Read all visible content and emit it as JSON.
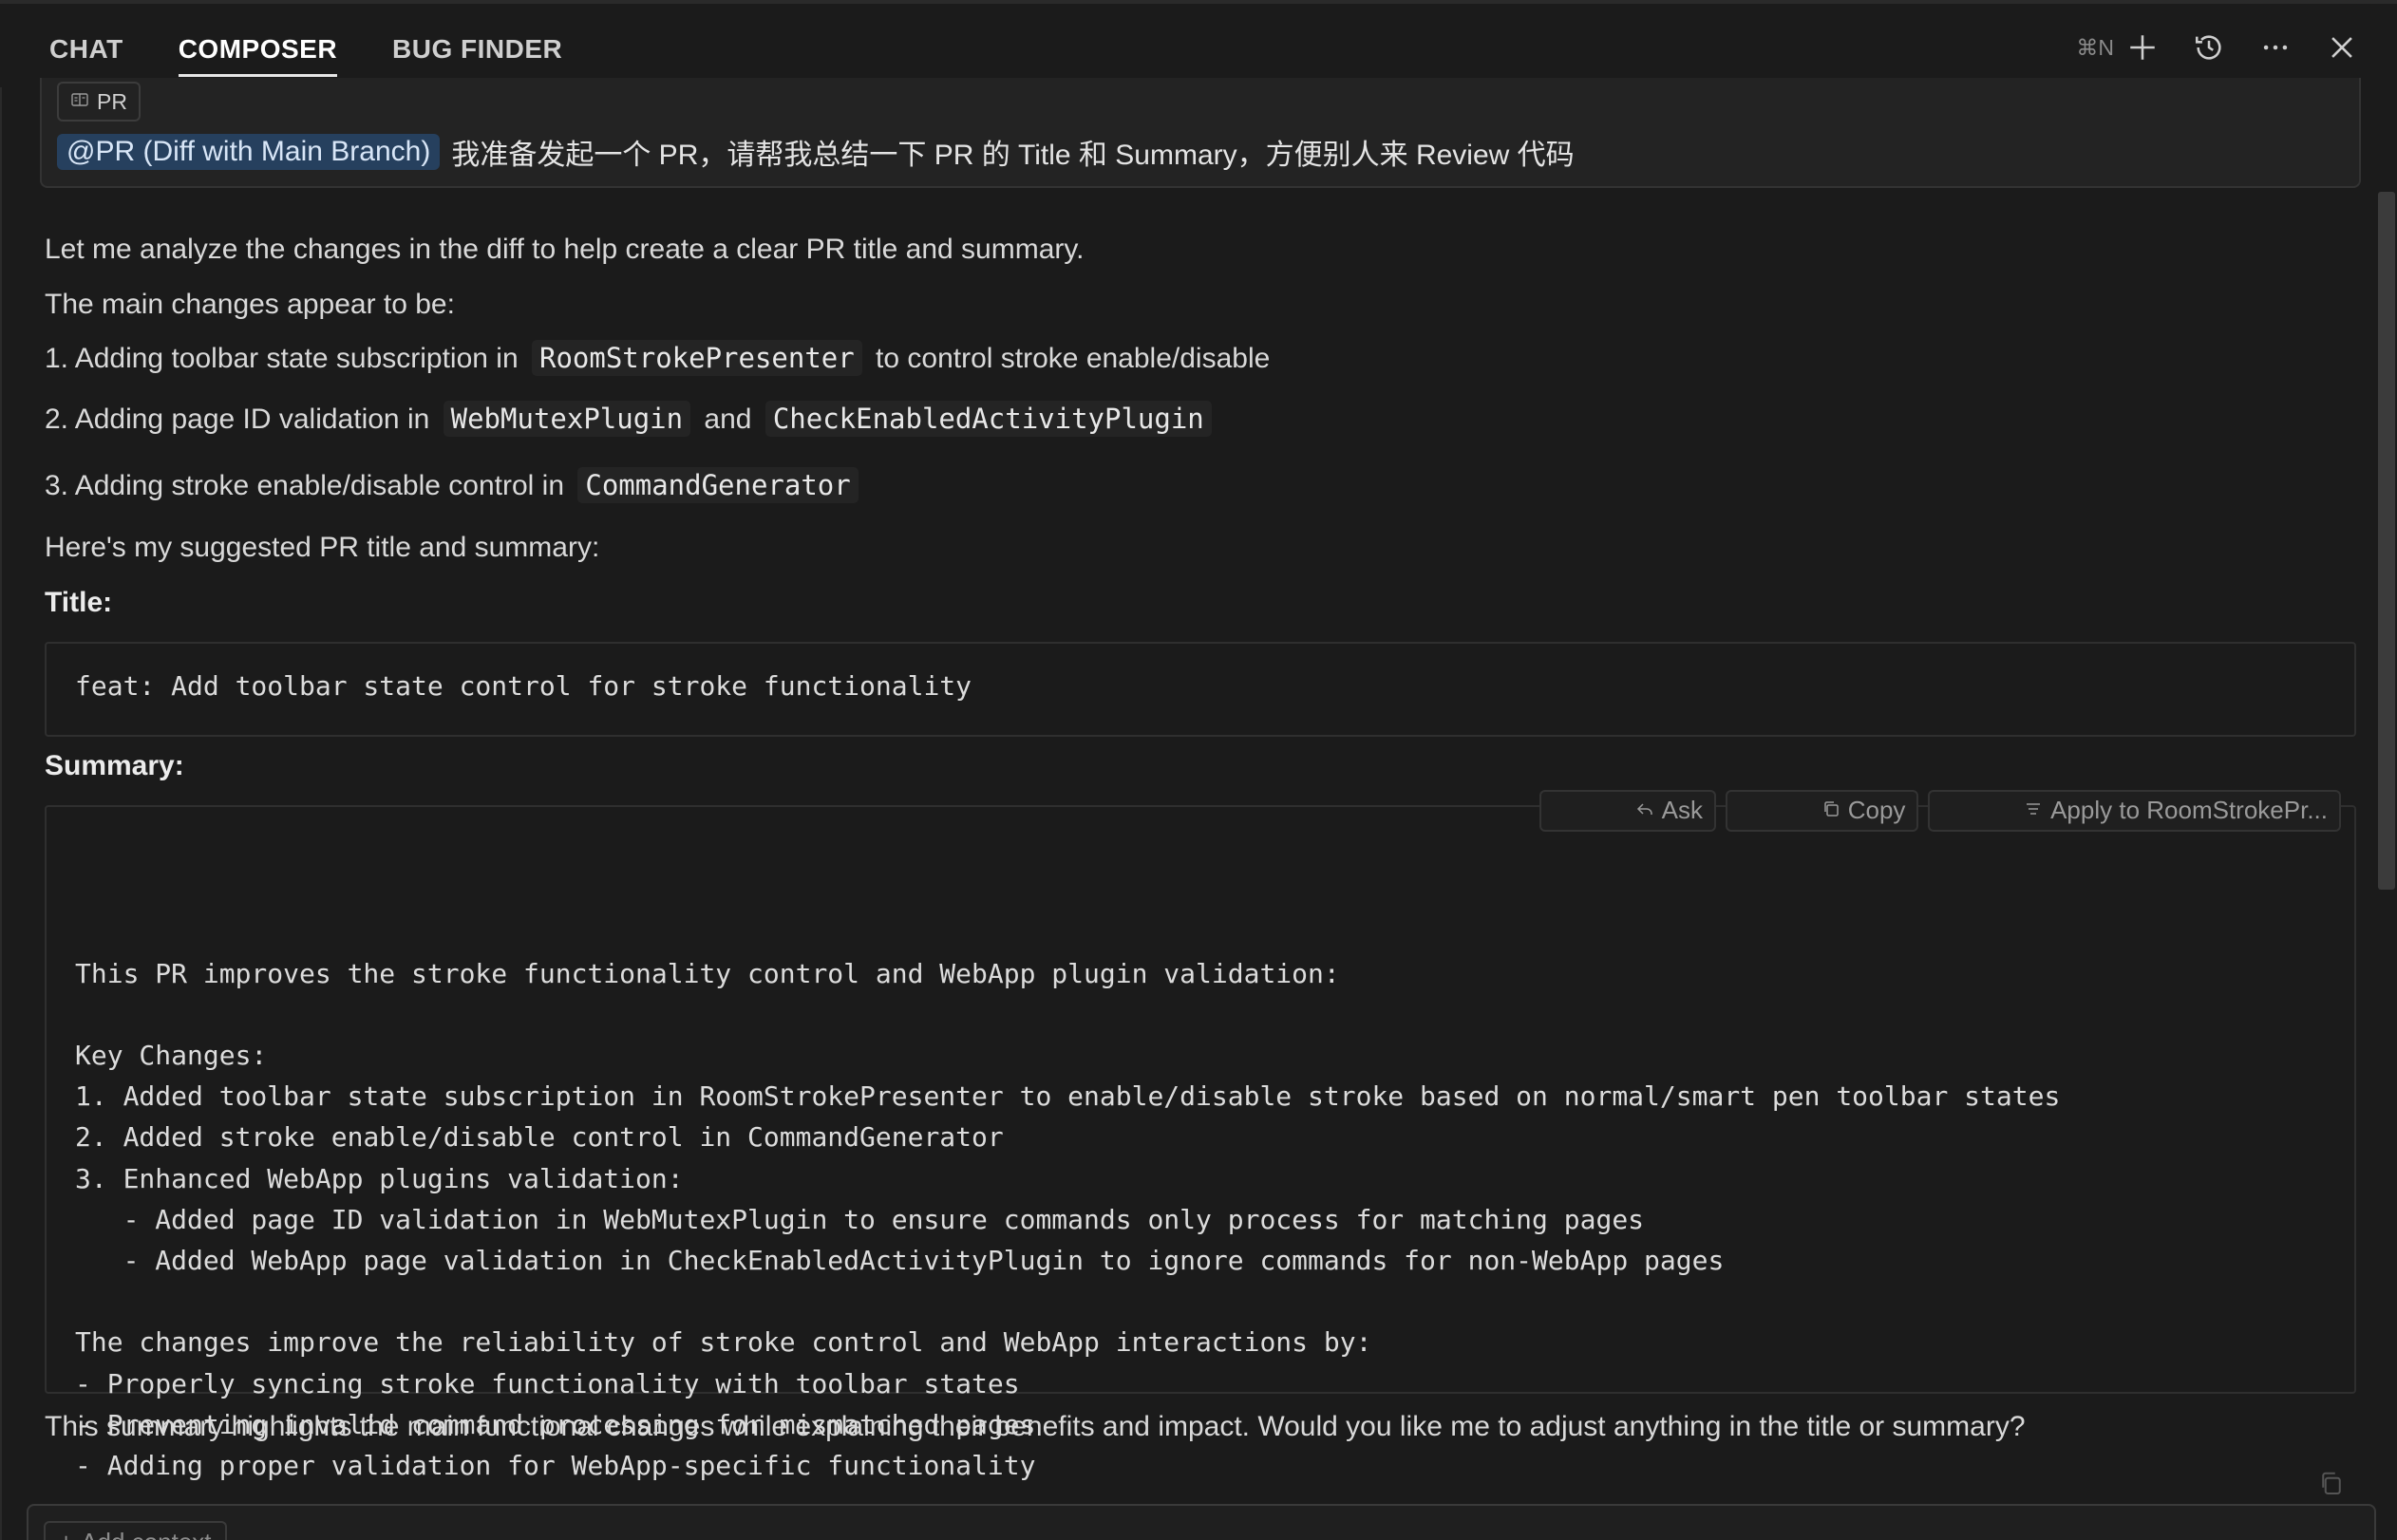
{
  "tabs": [
    {
      "label": "CHAT"
    },
    {
      "label": "COMPOSER"
    },
    {
      "label": "BUG FINDER"
    }
  ],
  "active_tab": "COMPOSER",
  "header": {
    "shortcut": "⌘N"
  },
  "user_message": {
    "chip_label": "PR",
    "mention": "@PR (Diff with Main Branch)",
    "text": "我准备发起一个 PR，请帮我总结一下 PR 的 Title 和 Summary，方便别人来 Review 代码"
  },
  "response": {
    "intro": "Let me analyze the changes in the diff to help create a clear PR title and summary.",
    "main_changes_heading": "The main changes appear to be:",
    "items": [
      {
        "prefix": "1. Adding toolbar state subscription in ",
        "code1": "RoomStrokePresenter",
        "mid": " to control stroke enable/disable",
        "code2": "",
        "suffix": ""
      },
      {
        "prefix": "2. Adding page ID validation in ",
        "code1": "WebMutexPlugin",
        "mid": " and ",
        "code2": "CheckEnabledActivityPlugin",
        "suffix": ""
      },
      {
        "prefix": "3. Adding stroke enable/disable control in ",
        "code1": "CommandGenerator",
        "mid": "",
        "code2": "",
        "suffix": ""
      }
    ],
    "suggested_heading": "Here's my suggested PR title and summary:",
    "title_label": "Title:",
    "title_code": "feat: Add toolbar state control for stroke functionality",
    "summary_label": "Summary:",
    "summary_code": "This PR improves the stroke functionality control and WebApp plugin validation:\n\nKey Changes:\n1. Added toolbar state subscription in RoomStrokePresenter to enable/disable stroke based on normal/smart pen toolbar states\n2. Added stroke enable/disable control in CommandGenerator\n3. Enhanced WebApp plugins validation:\n   - Added page ID validation in WebMutexPlugin to ensure commands only process for matching pages\n   - Added WebApp page validation in CheckEnabledActivityPlugin to ignore commands for non-WebApp pages\n\nThe changes improve the reliability of stroke control and WebApp interactions by:\n- Properly syncing stroke functionality with toolbar states\n- Preventing invalid command processing for mismatched pages\n- Adding proper validation for WebApp-specific functionality",
    "closing": "This summary highlights the main functional changes while explaining their benefits and impact. Would you like me to adjust anything in the title or summary?"
  },
  "code_actions": {
    "ask": "Ask",
    "copy": "Copy",
    "apply": "Apply to RoomStrokePr..."
  },
  "footer": {
    "add_context": "Add context"
  },
  "colors": {
    "background": "#1b1b1b",
    "mention_bg": "#26405e",
    "text": "#d9d9d9"
  }
}
